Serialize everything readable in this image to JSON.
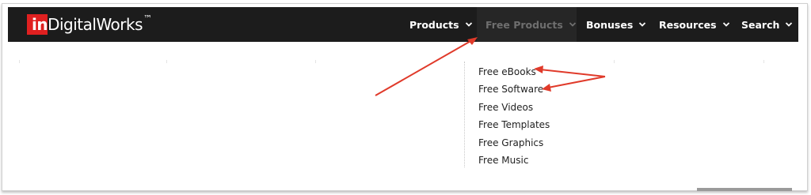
{
  "logo": {
    "prefix": "in",
    "name": "DigitalWorks",
    "trademark": "™"
  },
  "nav": {
    "items": [
      {
        "label": "Products",
        "active": false
      },
      {
        "label": "Free Products",
        "active": true
      },
      {
        "label": "Bonuses",
        "active": false
      },
      {
        "label": "Resources",
        "active": false
      },
      {
        "label": "Search",
        "active": false
      }
    ]
  },
  "dropdown": {
    "items": [
      "Free eBooks",
      "Free Software",
      "Free Videos",
      "Free Templates",
      "Free Graphics",
      "Free Music"
    ]
  },
  "colors": {
    "navbar_bg": "#1c1c1c",
    "active_tab_bg": "#262626",
    "active_tab_text": "#6e6e6e",
    "logo_red": "#e02020",
    "annotation_arrow": "#e03a2a"
  },
  "icons": {
    "nav_caret": "chevron-down-icon"
  }
}
